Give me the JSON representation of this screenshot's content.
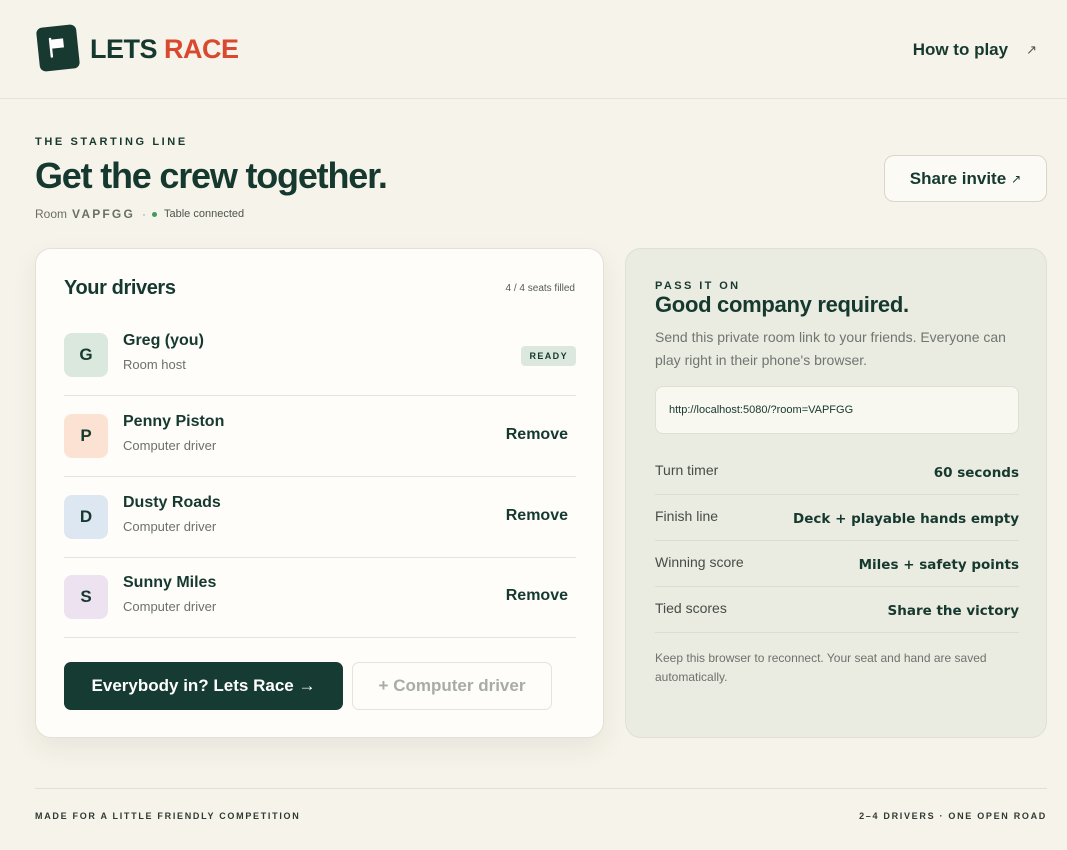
{
  "brand": {
    "word1": "LETS",
    "word2": "RACE",
    "accent": "#d9492f",
    "ink": "#16392f"
  },
  "nav": {
    "how_to_play": "How to play",
    "arrow": "↗"
  },
  "hero": {
    "eyebrow": "THE STARTING LINE",
    "title": "Get the crew together.",
    "room_label": "Room",
    "room_code": "VAPFGG",
    "separator": "·",
    "status": "Table connected"
  },
  "share": {
    "label": "Share invite",
    "arrow": "↗"
  },
  "drivers": {
    "title": "Your drivers",
    "seats": "4 / 4 seats filled",
    "list": [
      {
        "initial": "G",
        "name": "Greg (you)",
        "role": "Room host",
        "badge": "READY",
        "color": "#dbe8dd"
      },
      {
        "initial": "P",
        "name": "Penny Piston",
        "role": "Computer driver",
        "action": "Remove",
        "color": "#fbe2d2"
      },
      {
        "initial": "D",
        "name": "Dusty Roads",
        "role": "Computer driver",
        "action": "Remove",
        "color": "#dde7f2"
      },
      {
        "initial": "S",
        "name": "Sunny Miles",
        "role": "Computer driver",
        "action": "Remove",
        "color": "#ece2f0"
      }
    ],
    "start_button": "Everybody in? Lets Race →",
    "add_button": "+ Computer driver"
  },
  "invite": {
    "eyebrow": "PASS IT ON",
    "title": "Good company required.",
    "description": "Send this private room link to your friends. Everyone can play right in their phone's browser.",
    "link": "http://localhost:5080/?room=VAPFGG",
    "settings": [
      {
        "label": "Turn timer",
        "value": "60 seconds"
      },
      {
        "label": "Finish line",
        "value": "Deck + playable hands empty"
      },
      {
        "label": "Winning score",
        "value": "Miles + safety points"
      },
      {
        "label": "Tied scores",
        "value": "Share the victory"
      }
    ],
    "footnote": "Keep this browser to reconnect. Your seat and hand are saved automatically."
  },
  "footer": {
    "left": "MADE FOR A LITTLE FRIENDLY COMPETITION",
    "right": "2–4 DRIVERS · ONE OPEN ROAD"
  },
  "icons": {
    "logo": "flag-icon",
    "external": "arrow-up-right-icon"
  }
}
